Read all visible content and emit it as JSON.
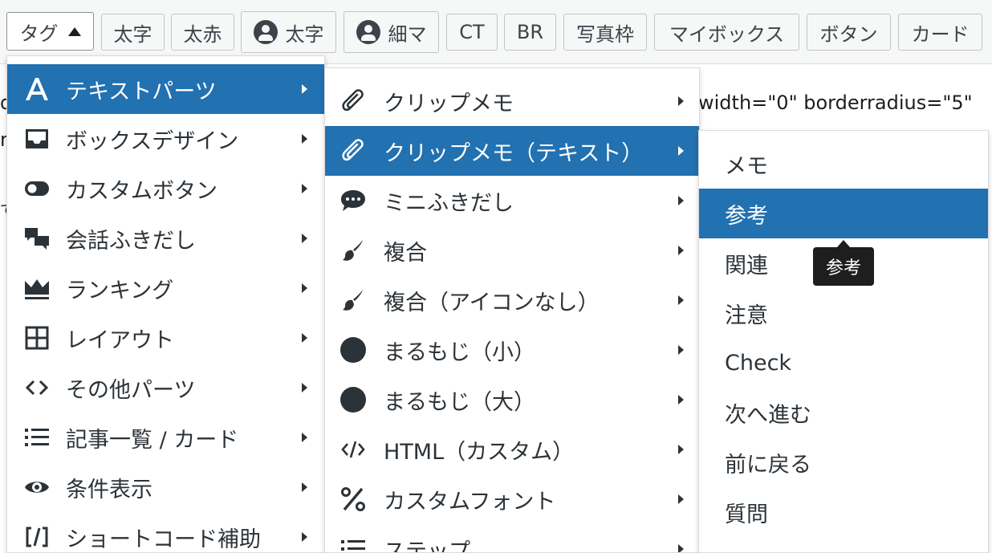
{
  "toolbar": {
    "tag_label": "タグ",
    "buttons": [
      "太字",
      "太赤",
      "太字",
      "細マ",
      "CT",
      "BR",
      "写真枠",
      "マイボックス",
      "ボタン",
      "カード"
    ]
  },
  "editor_fragments": {
    "attrs": "width=\"0\" borderradius=\"5\"",
    "frag1": "d",
    "frag2": "r",
    "frag3": "で"
  },
  "menu1": {
    "items": [
      {
        "label": "テキストパーツ",
        "icon": "letter-a-icon"
      },
      {
        "label": "ボックスデザイン",
        "icon": "inbox-icon"
      },
      {
        "label": "カスタムボタン",
        "icon": "toggle-icon"
      },
      {
        "label": "会話ふきだし",
        "icon": "chat-bubbles-icon"
      },
      {
        "label": "ランキング",
        "icon": "crown-icon"
      },
      {
        "label": "レイアウト",
        "icon": "grid-icon"
      },
      {
        "label": "その他パーツ",
        "icon": "code-brackets-icon"
      },
      {
        "label": "記事一覧 / カード",
        "icon": "list-icon"
      },
      {
        "label": "条件表示",
        "icon": "eye-icon"
      },
      {
        "label": "ショートコード補助",
        "icon": "shortcode-icon"
      }
    ]
  },
  "menu2": {
    "items": [
      {
        "label": "クリップメモ",
        "icon": "paperclip-icon"
      },
      {
        "label": "クリップメモ（テキスト）",
        "icon": "paperclip-icon"
      },
      {
        "label": "ミニふきだし",
        "icon": "speech-bubble-icon"
      },
      {
        "label": "複合",
        "icon": "brush-icon"
      },
      {
        "label": "複合（アイコンなし）",
        "icon": "brush-icon"
      },
      {
        "label": "まるもじ（小）",
        "icon": "circle-icon"
      },
      {
        "label": "まるもじ（大）",
        "icon": "circle-icon"
      },
      {
        "label": "HTML（カスタム）",
        "icon": "code-slash-icon"
      },
      {
        "label": "カスタムフォント",
        "icon": "percent-icon"
      },
      {
        "label": "ステップ",
        "icon": "list-icon"
      }
    ]
  },
  "menu3": {
    "items": [
      "メモ",
      "参考",
      "関連",
      "注意",
      "Check",
      "次へ進む",
      "前に戻る",
      "質問"
    ]
  },
  "tooltip": "参考",
  "colors": {
    "active": "#2271b1",
    "text": "#2c3338",
    "tooltip_bg": "#1e1e1e"
  }
}
